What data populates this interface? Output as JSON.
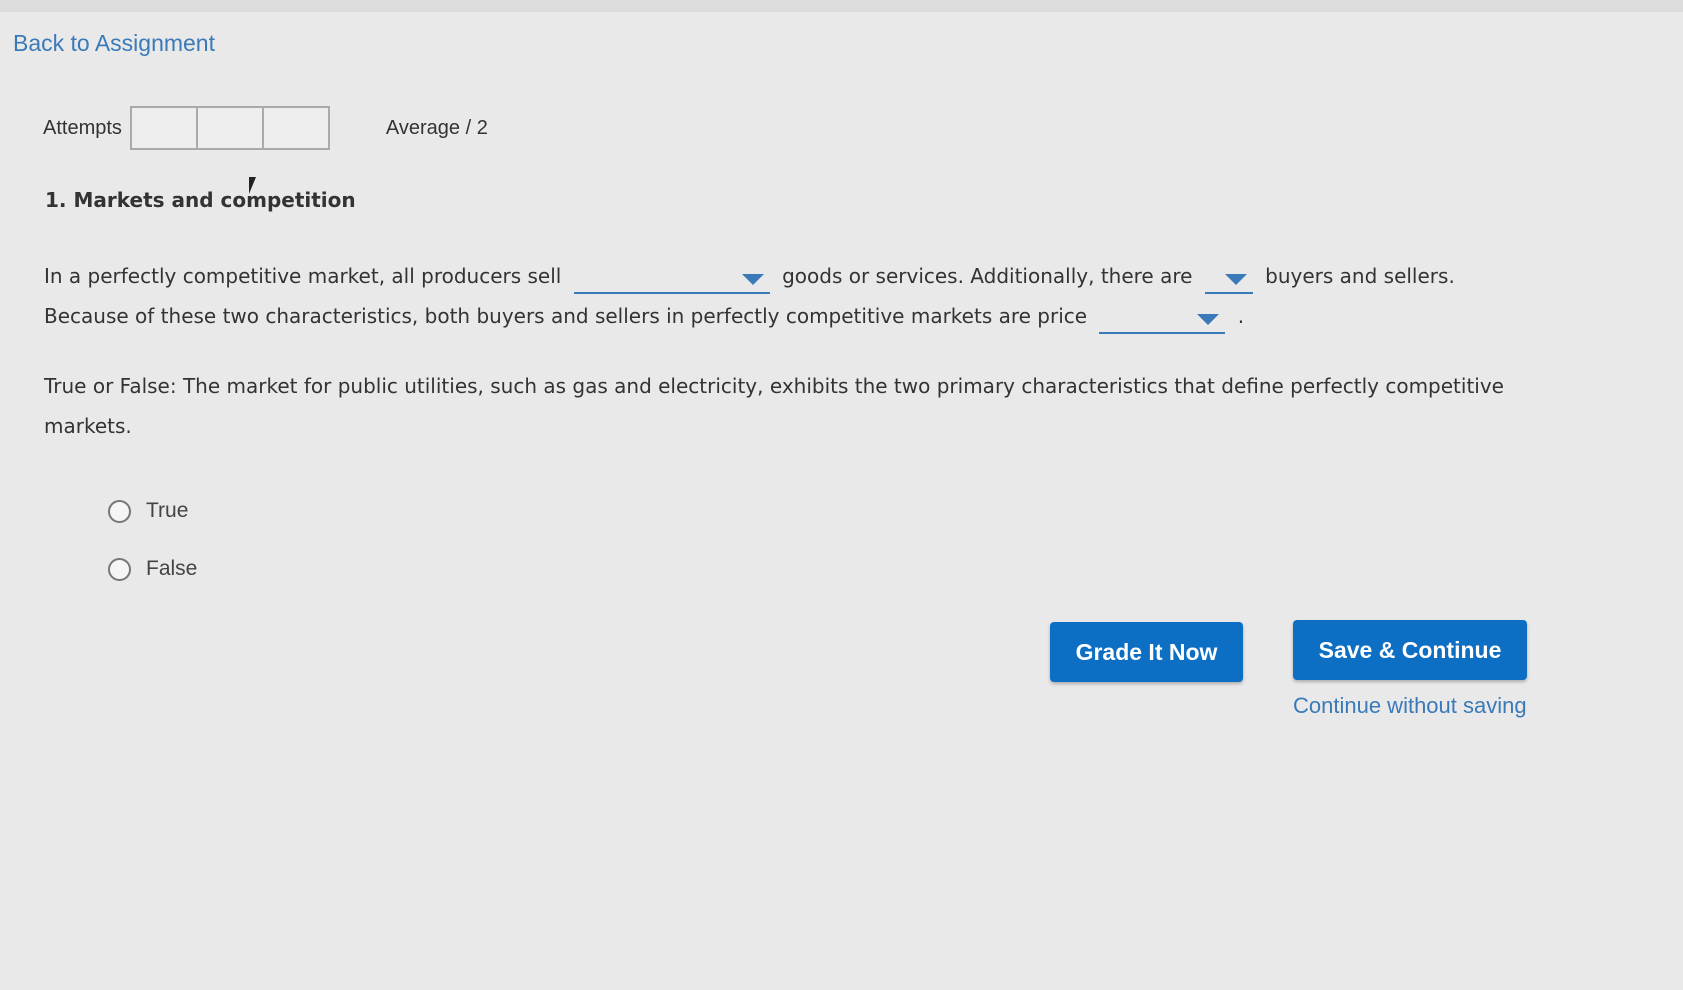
{
  "nav": {
    "back_link": "Back to Assignment"
  },
  "attempts": {
    "label": "Attempts",
    "average": "Average / 2"
  },
  "question": {
    "title": "1. Markets and competition",
    "p1_part1": "In a perfectly competitive market, all producers sell",
    "p1_part2": "goods or services. Additionally, there are",
    "p1_part3": "buyers and sellers. Because of these two characteristics, both buyers and sellers in perfectly competitive markets are price",
    "p1_end": ".",
    "p2": "True or False: The market for public utilities, such as gas and electricity, exhibits the two primary characteristics that define perfectly competitive markets.",
    "options": [
      "True",
      "False"
    ]
  },
  "actions": {
    "grade_label": "Grade It Now",
    "save_label": "Save & Continue",
    "continue_label": "Continue without saving"
  },
  "colors": {
    "link": "#3a7ab8",
    "button": "#0d6fc4",
    "background": "#e9e9e9"
  }
}
